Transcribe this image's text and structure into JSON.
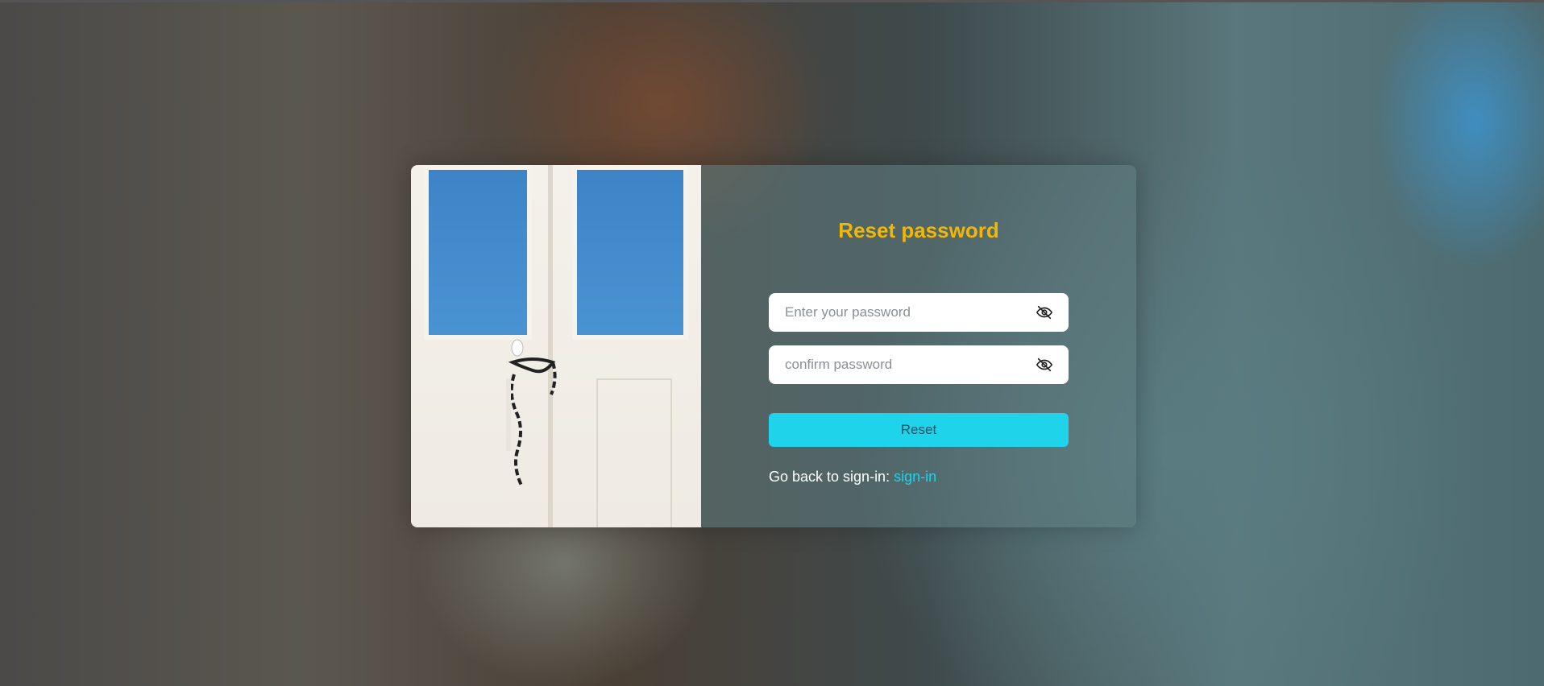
{
  "form": {
    "title": "Reset password",
    "password_placeholder": "Enter your password",
    "confirm_placeholder": "confirm password",
    "reset_label": "Reset",
    "back_text": "Go back to sign-in: ",
    "back_link": "sign-in"
  },
  "icons": {
    "password_toggle": "eye-off-icon",
    "confirm_toggle": "eye-off-icon"
  },
  "colors": {
    "title": "#f2b705",
    "button": "#1fd3ea",
    "link": "#1fd3ea"
  }
}
